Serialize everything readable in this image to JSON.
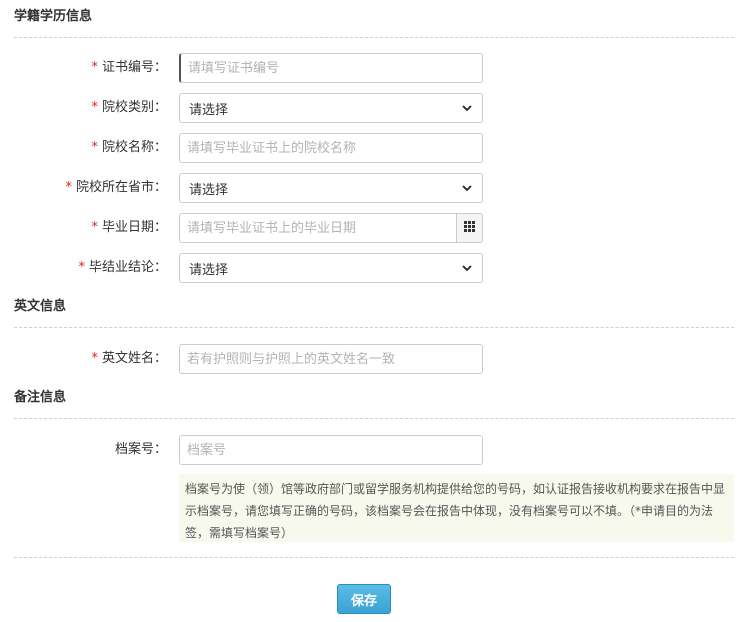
{
  "sections": {
    "education": {
      "title": "学籍学历信息"
    },
    "english": {
      "title": "英文信息"
    },
    "remarks": {
      "title": "备注信息"
    }
  },
  "fields": {
    "certificate_number": {
      "label": "证书编号：",
      "placeholder": "请填写证书编号",
      "required": "*"
    },
    "school_category": {
      "label": "院校类别：",
      "value": "请选择",
      "required": "*"
    },
    "school_name": {
      "label": "院校名称：",
      "placeholder": "请填写毕业证书上的院校名称",
      "required": "*"
    },
    "school_province_city": {
      "label": "院校所在省市：",
      "value": "请选择",
      "required": "*"
    },
    "graduation_date": {
      "label": "毕业日期：",
      "placeholder": "请填写毕业证书上的毕业日期",
      "required": "*"
    },
    "graduation_conclusion": {
      "label": "毕结业结论：",
      "value": "请选择",
      "required": "*"
    },
    "english_name": {
      "label": "英文姓名：",
      "placeholder": "若有护照则与护照上的英文姓名一致",
      "required": "*"
    },
    "file_number": {
      "label": "档案号：",
      "placeholder": "档案号"
    }
  },
  "note": {
    "text": "档案号为使（领）馆等政府部门或留学服务机构提供给您的号码，如认证报告接收机构要求在报告中显示档案号，请您填写正确的号码，该档案号会在报告中体现，没有档案号可以不填。（*申请目的为法签，需填写档案号）"
  },
  "actions": {
    "save_label": "保存"
  },
  "icons": {
    "select_arrow": "chevron-down-icon",
    "calendar": "calendar-grid-icon"
  },
  "colors": {
    "required": "#e02020",
    "save_button": "#3aa3d4",
    "note_bg": "#f7f9ec"
  }
}
